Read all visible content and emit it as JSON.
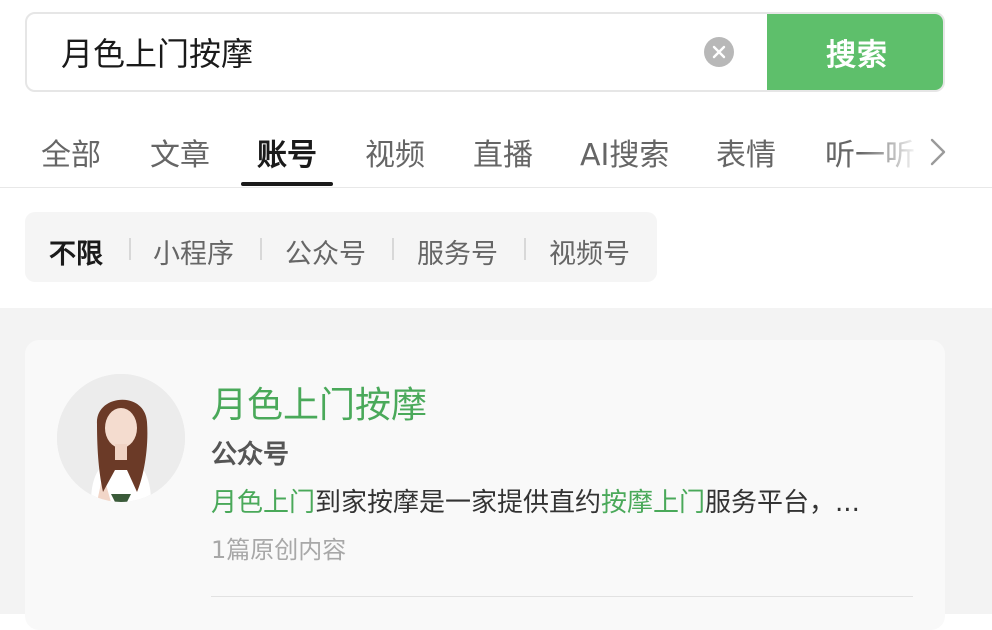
{
  "search": {
    "query": "月色上门按摩",
    "button_label": "搜索"
  },
  "tabs": [
    {
      "label": "全部"
    },
    {
      "label": "文章"
    },
    {
      "label": "账号"
    },
    {
      "label": "视频"
    },
    {
      "label": "直播"
    },
    {
      "label": "AI搜索"
    },
    {
      "label": "表情"
    },
    {
      "label": "听一听"
    }
  ],
  "active_tab": "账号",
  "filters": [
    {
      "label": "不限"
    },
    {
      "label": "小程序"
    },
    {
      "label": "公众号"
    },
    {
      "label": "服务号"
    },
    {
      "label": "视频号"
    }
  ],
  "active_filter": "不限",
  "result": {
    "title": "月色上门按摩",
    "type": "公众号",
    "desc_parts": [
      {
        "text": "月色上门",
        "highlight": true
      },
      {
        "text": "到家按摩是一家提供直约",
        "highlight": false
      },
      {
        "text": "按摩上门",
        "highlight": true
      },
      {
        "text": "服务平台，...",
        "highlight": false
      }
    ],
    "meta": "1篇原创内容"
  },
  "colors": {
    "accent_green": "#5ebf6b",
    "highlight_green": "#4aa95a"
  },
  "icons": {
    "clear": "clear-circle-icon",
    "more_tabs": "chevron-right-icon"
  }
}
